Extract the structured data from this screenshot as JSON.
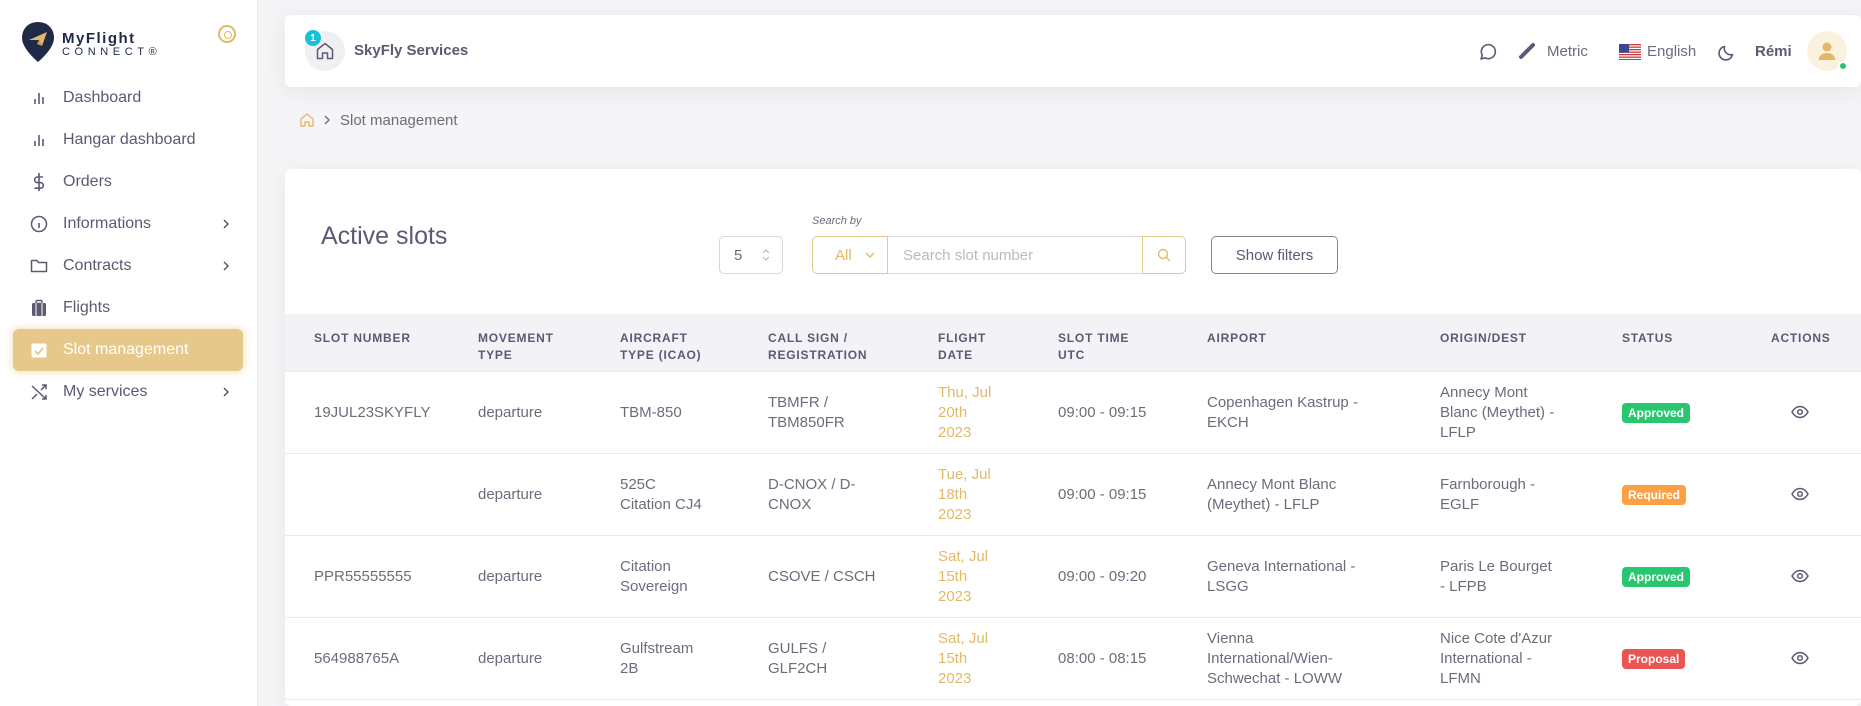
{
  "app": {
    "logo_title": "MyFlight",
    "logo_sub": "CONNECT®"
  },
  "sidebar": {
    "items": [
      {
        "label": "Dashboard",
        "icon": "bar-chart-icon",
        "has_children": false,
        "active": false
      },
      {
        "label": "Hangar dashboard",
        "icon": "bar-chart-icon",
        "has_children": false,
        "active": false
      },
      {
        "label": "Orders",
        "icon": "dollar-icon",
        "has_children": false,
        "active": false
      },
      {
        "label": "Informations",
        "icon": "info-icon",
        "has_children": true,
        "active": false
      },
      {
        "label": "Contracts",
        "icon": "folder-icon",
        "has_children": true,
        "active": false
      },
      {
        "label": "Flights",
        "icon": "suitcase-icon",
        "has_children": false,
        "active": false
      },
      {
        "label": "Slot management",
        "icon": "calendar-check-icon",
        "has_children": false,
        "active": true
      },
      {
        "label": "My services",
        "icon": "shuffle-icon",
        "has_children": true,
        "active": false
      }
    ]
  },
  "header": {
    "notification_count": "1",
    "company": "SkyFly Services",
    "units": "Metric",
    "language": "English",
    "user": "Rémi"
  },
  "breadcrumb": {
    "current": "Slot management"
  },
  "card": {
    "title": "Active slots",
    "per_page": "5",
    "search_by_label": "Search by",
    "search_scope": "All",
    "search_placeholder": "Search slot number",
    "show_filters_label": "Show filters"
  },
  "table": {
    "columns": [
      [
        "SLOT NUMBER"
      ],
      [
        "MOVEMENT",
        "TYPE"
      ],
      [
        "AIRCRAFT",
        "TYPE (ICAO)"
      ],
      [
        "CALL SIGN /",
        "REGISTRATION"
      ],
      [
        "FLIGHT",
        "DATE"
      ],
      [
        "SLOT TIME",
        "UTC"
      ],
      [
        "AIRPORT"
      ],
      [
        "ORIGIN/DEST"
      ],
      [
        "STATUS"
      ],
      [
        "ACTIONS"
      ]
    ],
    "rows": [
      {
        "slot_number": "19JUL23SKYFLY",
        "movement": "departure",
        "aircraft": [
          "TBM-850"
        ],
        "callsign": [
          "TBMFR /",
          "TBM850FR"
        ],
        "date": [
          "Thu, Jul",
          "20th",
          "2023"
        ],
        "slot_time": "09:00 - 09:15",
        "airport": [
          "Copenhagen Kastrup -",
          "EKCH"
        ],
        "origin_dest": [
          "Annecy Mont",
          "Blanc (Meythet) -",
          "LFLP"
        ],
        "status": "Approved",
        "status_color": "#28c76f"
      },
      {
        "slot_number": "",
        "movement": "departure",
        "aircraft": [
          "525C",
          "Citation CJ4"
        ],
        "callsign": [
          "D-CNOX / D-",
          "CNOX"
        ],
        "date": [
          "Tue, Jul",
          "18th",
          "2023"
        ],
        "slot_time": "09:00 - 09:15",
        "airport": [
          "Annecy Mont Blanc",
          "(Meythet) - LFLP"
        ],
        "origin_dest": [
          "Farnborough -",
          "EGLF"
        ],
        "status": "Required",
        "status_color": "#ff9f43"
      },
      {
        "slot_number": "PPR55555555",
        "movement": "departure",
        "aircraft": [
          "Citation",
          "Sovereign"
        ],
        "callsign": [
          "CSOVE / CSCH"
        ],
        "date": [
          "Sat, Jul",
          "15th",
          "2023"
        ],
        "slot_time": "09:00 - 09:20",
        "airport": [
          "Geneva International -",
          "LSGG"
        ],
        "origin_dest": [
          "Paris Le Bourget",
          "- LFPB"
        ],
        "status": "Approved",
        "status_color": "#28c76f"
      },
      {
        "slot_number": "564988765A",
        "movement": "departure",
        "aircraft": [
          "Gulfstream",
          "2B"
        ],
        "callsign": [
          "GULFS /",
          "GLF2CH"
        ],
        "date": [
          "Sat, Jul",
          "15th",
          "2023"
        ],
        "slot_time": "08:00 - 08:15",
        "airport": [
          "Vienna",
          "International/Wien-",
          "Schwechat - LOWW"
        ],
        "origin_dest": [
          "Nice Cote d'Azur",
          "International -",
          "LFMN"
        ],
        "status": "Proposal",
        "status_color": "#ea5455"
      }
    ]
  },
  "colors": {
    "accent": "#e6c98a",
    "accent_text": "#e3b968",
    "approved": "#28c76f",
    "required": "#ff9f43",
    "proposal": "#ea5455",
    "online": "#28c76f",
    "notification": "#17c1d6"
  }
}
